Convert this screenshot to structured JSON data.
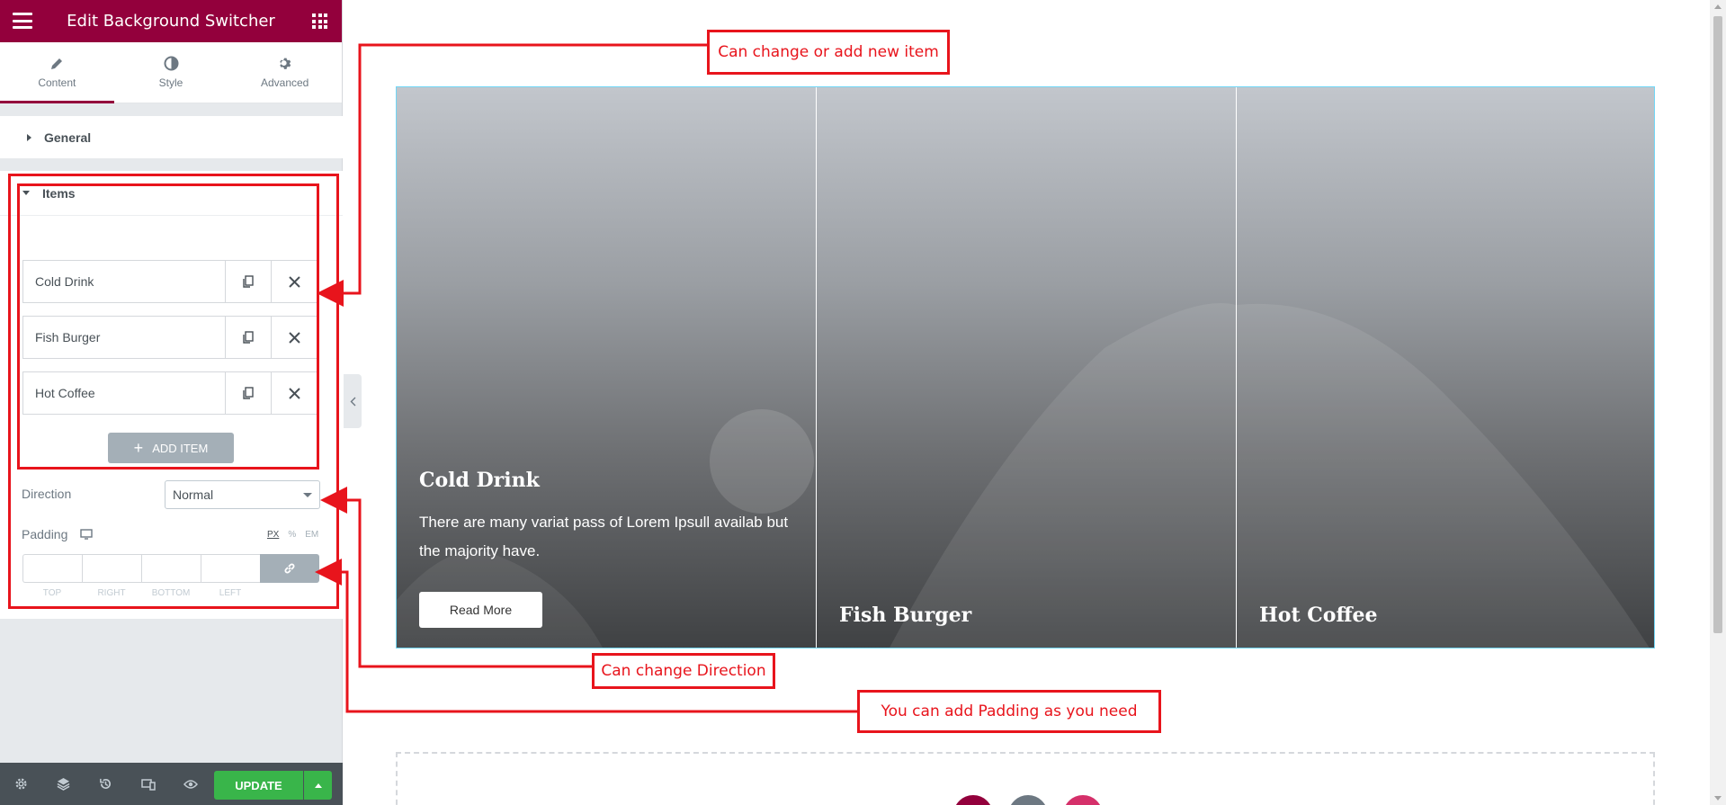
{
  "panel": {
    "header_title": "Edit Background Switcher",
    "tabs": [
      {
        "label": "Content",
        "icon": "pencil-icon"
      },
      {
        "label": "Style",
        "icon": "half-circle-icon"
      },
      {
        "label": "Advanced",
        "icon": "gear-icon"
      }
    ],
    "general_label": "General",
    "items_label": "Items",
    "items": [
      {
        "label": "Cold Drink"
      },
      {
        "label": "Fish Burger"
      },
      {
        "label": "Hot Coffee"
      }
    ],
    "add_item_label": "ADD ITEM",
    "direction_label": "Direction",
    "direction_value": "Normal",
    "padding_label": "Padding",
    "padding_units": [
      "PX",
      "%",
      "EM"
    ],
    "padding_captions": [
      "TOP",
      "RIGHT",
      "BOTTOM",
      "LEFT"
    ],
    "update_label": "UPDATE",
    "accent_color": "#93003c",
    "update_color": "#39b54a"
  },
  "preview": {
    "items": [
      {
        "title": "Cold Drink",
        "text": "There are many variat pass of Lorem Ipsull availab but the majority have.",
        "button": "Read More"
      },
      {
        "title": "Fish Burger"
      },
      {
        "title": "Hot Coffee"
      }
    ]
  },
  "annotations": {
    "items_note": "Can change or add new item",
    "direction_note": "Can change Direction",
    "padding_note": "You can add Padding as you need",
    "color": "#e8141c"
  }
}
